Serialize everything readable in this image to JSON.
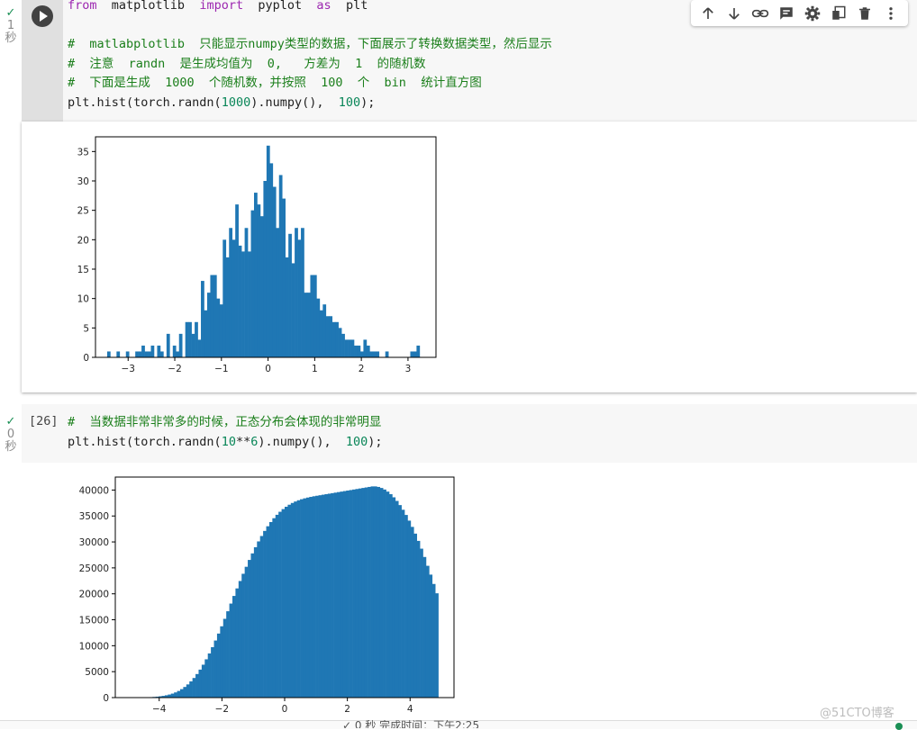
{
  "cell1": {
    "status_check": "✓",
    "time_value": "1",
    "time_unit": "秒",
    "code": {
      "line1_kw1": "from",
      "line1_mod": "matplotlib",
      "line1_kw2": "import",
      "line1_name": "pyplot",
      "line1_kw3": "as",
      "line1_alias": "plt",
      "comment1": "#  matlabplotlib  只能显示numpy类型的数据，下面展示了转换数据类型，然后显示",
      "comment2": "#  注意  randn  是生成均值为  0,   方差为  1  的随机数",
      "comment3": "#  下面是生成  1000  个随机数，并按照  100  个  bin  统计直方图",
      "line5_a": "plt.hist(torch.randn(",
      "line5_n1": "1000",
      "line5_b": ").numpy(),  ",
      "line5_n2": "100",
      "line5_c": ");"
    }
  },
  "toolbar": {
    "icons": [
      "arrow-up-icon",
      "arrow-down-icon",
      "link-icon",
      "comment-icon",
      "gear-icon",
      "mirror-cell-icon",
      "trash-icon",
      "more-vert-icon"
    ]
  },
  "cell2": {
    "status_check": "✓",
    "time_value": "0",
    "time_unit": "秒",
    "exec_count": "[26]",
    "code": {
      "comment1": "#  当数据非常非常多的时候，正态分布会体现的非常明显",
      "line2_a": "plt.hist(torch.randn(",
      "line2_n1": "10",
      "line2_op": "**",
      "line2_n2": "6",
      "line2_b": ").numpy(),  ",
      "line2_n3": "100",
      "line2_c": ");"
    }
  },
  "chart_data": [
    {
      "type": "bar",
      "title": "",
      "xlabel": "",
      "ylabel": "",
      "xlim": [
        -3.7,
        3.6
      ],
      "ylim": [
        0,
        37.5
      ],
      "xticks": [
        -3,
        -2,
        -1,
        0,
        1,
        2,
        3
      ],
      "yticks": [
        0,
        5,
        10,
        15,
        20,
        25,
        30,
        35
      ],
      "bin_start": -3.45,
      "bin_width": 0.067,
      "values": [
        1,
        0,
        0,
        1,
        0,
        0,
        1,
        0,
        0,
        1,
        1,
        2,
        1,
        1,
        2,
        0,
        2,
        1,
        0,
        4,
        0,
        2,
        1,
        4,
        0,
        6,
        6,
        4,
        6,
        3,
        13,
        8,
        11,
        14,
        14,
        10,
        9,
        20,
        17,
        22,
        20,
        26,
        19,
        18,
        22,
        18,
        25,
        28,
        26,
        24,
        30,
        36,
        33,
        29,
        22,
        31,
        27,
        17,
        21,
        16,
        22,
        20,
        22,
        11,
        11,
        14,
        14,
        10,
        8,
        9,
        7,
        7,
        6,
        6,
        5,
        4,
        3,
        3,
        3,
        2,
        2,
        1,
        3,
        2,
        1,
        1,
        1,
        0,
        0,
        1,
        0,
        0,
        0,
        0,
        0,
        0,
        0,
        1,
        1,
        2
      ]
    },
    {
      "type": "bar",
      "title": "",
      "xlabel": "",
      "ylabel": "",
      "xlim": [
        -5.4,
        5.4
      ],
      "ylim": [
        0,
        42500
      ],
      "xticks": [
        -4,
        -2,
        0,
        2,
        4
      ],
      "yticks": [
        0,
        5000,
        10000,
        15000,
        20000,
        25000,
        30000,
        35000,
        40000
      ],
      "bin_start": -4.9,
      "bin_width": 0.098,
      "values": [
        10,
        10,
        20,
        30,
        40,
        60,
        90,
        130,
        180,
        250,
        330,
        450,
        590,
        770,
        1000,
        1280,
        1630,
        2050,
        2540,
        3120,
        3780,
        4540,
        5390,
        6340,
        7380,
        8510,
        9720,
        11000,
        12340,
        13740,
        15180,
        16640,
        18120,
        19590,
        21040,
        22470,
        23860,
        25210,
        26530,
        27790,
        28980,
        30100,
        31140,
        32120,
        33020,
        33830,
        34570,
        35230,
        35810,
        36330,
        36780,
        37170,
        37510,
        37790,
        38030,
        38230,
        38400,
        38550,
        38680,
        38800,
        38900,
        39000,
        39100,
        39200,
        39300,
        39400,
        39500,
        39600,
        39700,
        39800,
        39900,
        40000,
        40100,
        40200,
        40300,
        40400,
        40500,
        40600,
        40700,
        40700,
        40600,
        40400,
        40100,
        39700,
        39200,
        38600,
        37900,
        37100,
        36200,
        35200,
        34100,
        32900,
        31600,
        30200,
        28700,
        27100,
        25400,
        23700,
        21900,
        20100
      ]
    }
  ],
  "watermark": "@51CTO博客",
  "statusbar": {
    "text": "✓ 0 秒   完成时间：下午2:25"
  }
}
